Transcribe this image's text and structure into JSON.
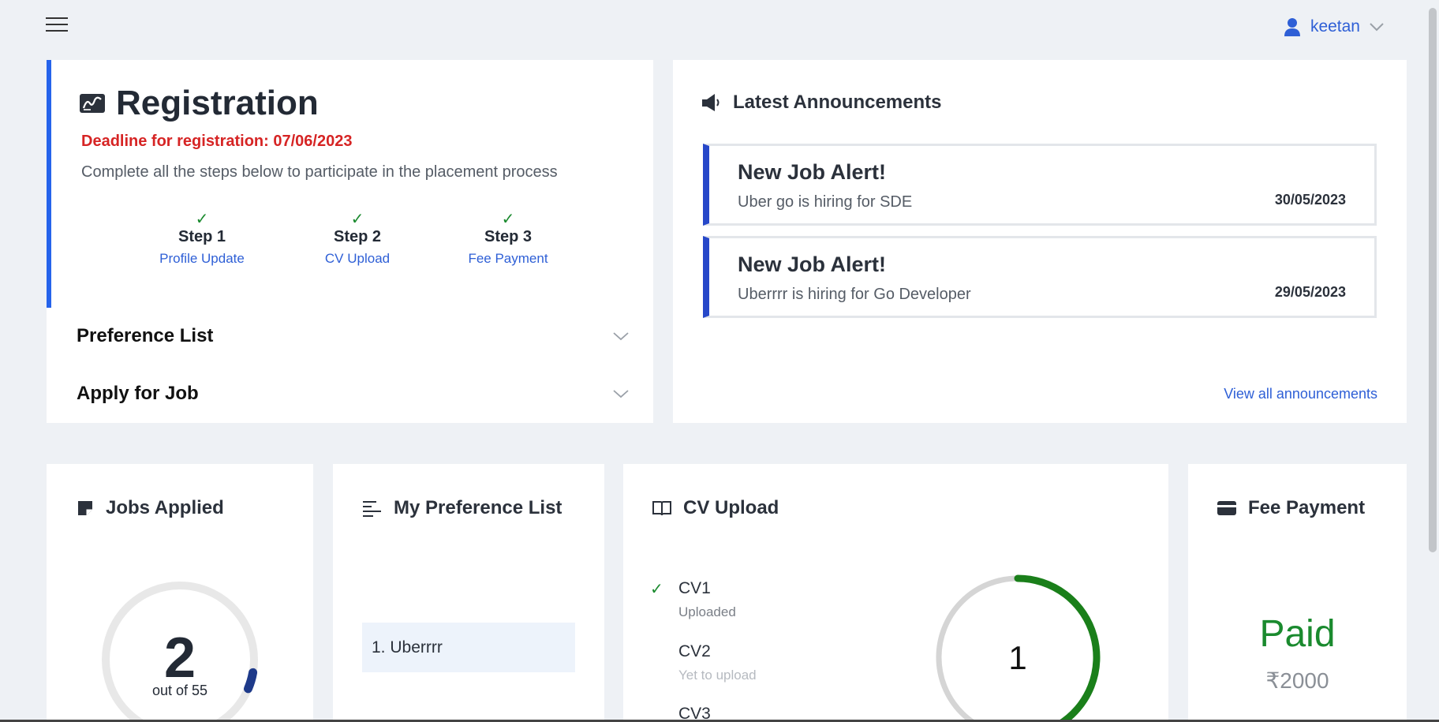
{
  "header": {
    "user_name": "keetan"
  },
  "registration": {
    "title": "Registration",
    "deadline": "Deadline for registration: 07/06/2023",
    "description": "Complete all the steps below to participate in the placement process",
    "steps": [
      {
        "label": "Step 1",
        "link": "Profile Update",
        "done": true
      },
      {
        "label": "Step 2",
        "link": "CV Upload",
        "done": true
      },
      {
        "label": "Step 3",
        "link": "Fee Payment",
        "done": true
      }
    ],
    "accordions": [
      "Preference List",
      "Apply for Job"
    ]
  },
  "announcements": {
    "title": "Latest Announcements",
    "items": [
      {
        "heading": "New Job Alert!",
        "text": "Uber go is hiring for SDE",
        "date": "30/05/2023"
      },
      {
        "heading": "New Job Alert!",
        "text": "Uberrrr is hiring for Go Developer",
        "date": "29/05/2023"
      }
    ],
    "view_all": "View all announcements"
  },
  "jobs_applied": {
    "title": "Jobs Applied",
    "count": "2",
    "total_label": "out of 55",
    "applied": 2,
    "total": 55
  },
  "preference_list": {
    "title": "My Preference List",
    "items": [
      "1. Uberrrr"
    ]
  },
  "cv_upload": {
    "title": "CV Upload",
    "items": [
      {
        "name": "CV1",
        "status": "Uploaded",
        "uploaded": true
      },
      {
        "name": "CV2",
        "status": "Yet to upload",
        "uploaded": false
      },
      {
        "name": "CV3",
        "status": "",
        "uploaded": false
      }
    ],
    "uploaded_count": "1",
    "progress_fraction": 0.33
  },
  "fee_payment": {
    "title": "Fee Payment",
    "status": "Paid",
    "amount": "₹2000"
  },
  "colors": {
    "accent_blue": "#2563eb",
    "link_blue": "#2e5fd6",
    "success_green": "#1a8a2e",
    "deadline_red": "#d62424",
    "jobs_ring": "#1e3a8a"
  }
}
